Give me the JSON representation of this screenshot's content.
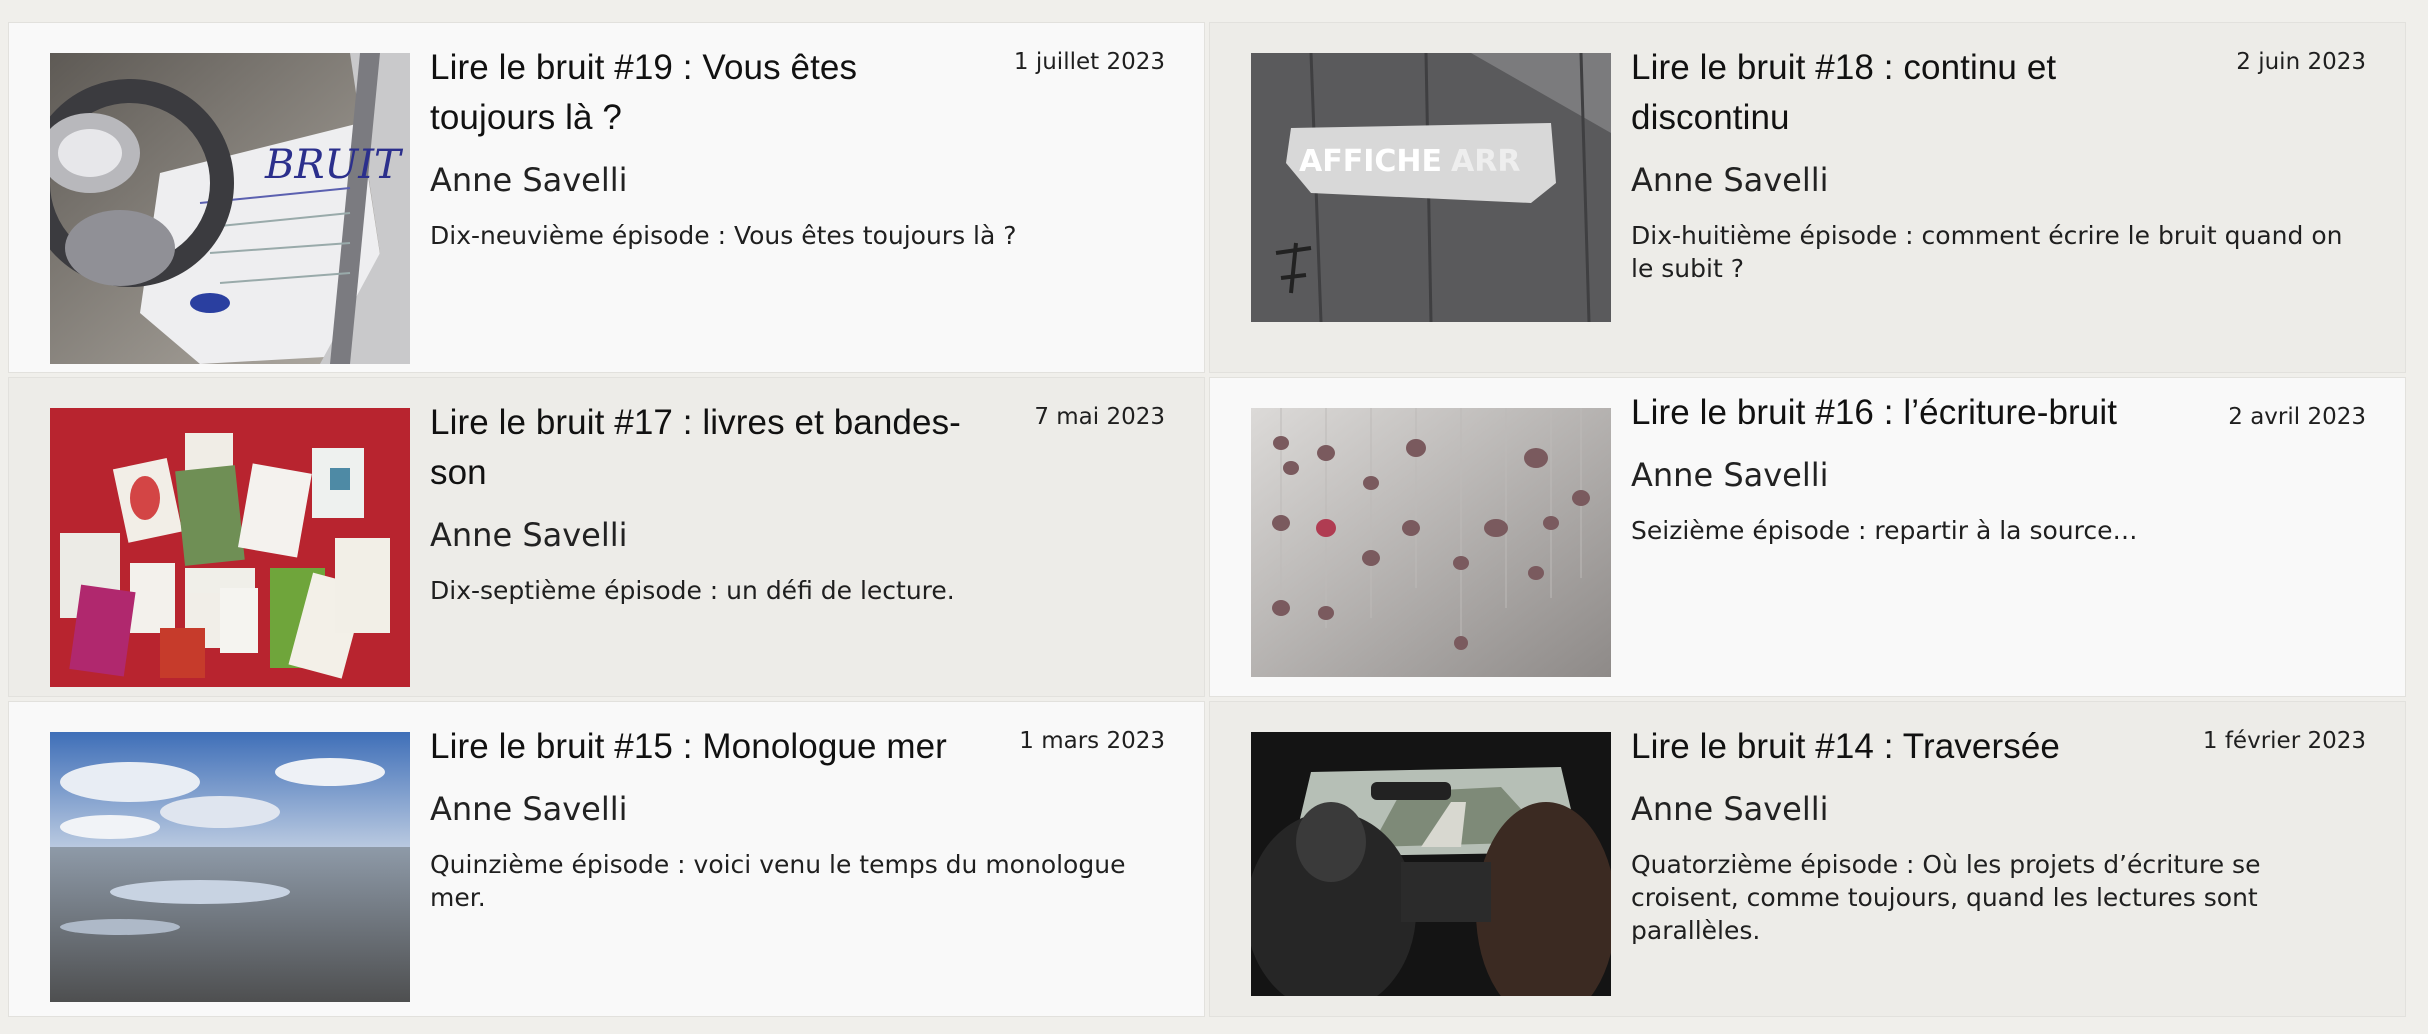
{
  "posts": [
    {
      "title": "Lire le bruit #19 : Vous êtes toujours là ?",
      "date": "1 juillet 2023",
      "author": "Anne Savelli",
      "excerpt": "Dix-neuvième épisode : Vous êtes toujours là ?",
      "image": "headphones-laptop-paper"
    },
    {
      "title": "Lire le bruit #18 : continu et discontinu",
      "date": "2 juin 2023",
      "author": "Anne Savelli",
      "excerpt": "Dix-huitième épisode : comment écrire le bruit quand on le subit ?",
      "image": "torn-poster-on-door"
    },
    {
      "title": "Lire le bruit #17 : livres et bandes-son",
      "date": "7 mai 2023",
      "author": "Anne Savelli",
      "excerpt": "Dix-septième épisode : un défi de lecture.",
      "image": "books-on-red-cloth"
    },
    {
      "title": "Lire le bruit #16 : l’écriture-bruit",
      "date": "2 avril 2023",
      "author": "Anne Savelli",
      "excerpt": "Seizième épisode : repartir à la source…",
      "image": "hanging-stones-installation"
    },
    {
      "title": "Lire le bruit #15 : Monologue mer",
      "date": "1 mars 2023",
      "author": "Anne Savelli",
      "excerpt": "Quinzième épisode : voici venu le temps du monologue mer.",
      "image": "beach-low-tide"
    },
    {
      "title": "Lire le bruit #14 : Traversée",
      "date": "1 février 2023",
      "author": "Anne Savelli",
      "excerpt": "Quatorzième épisode : Où les projets d’écriture se croisent, comme toujours, quand les lectures sont parallèles.",
      "image": "car-interior-road"
    }
  ]
}
